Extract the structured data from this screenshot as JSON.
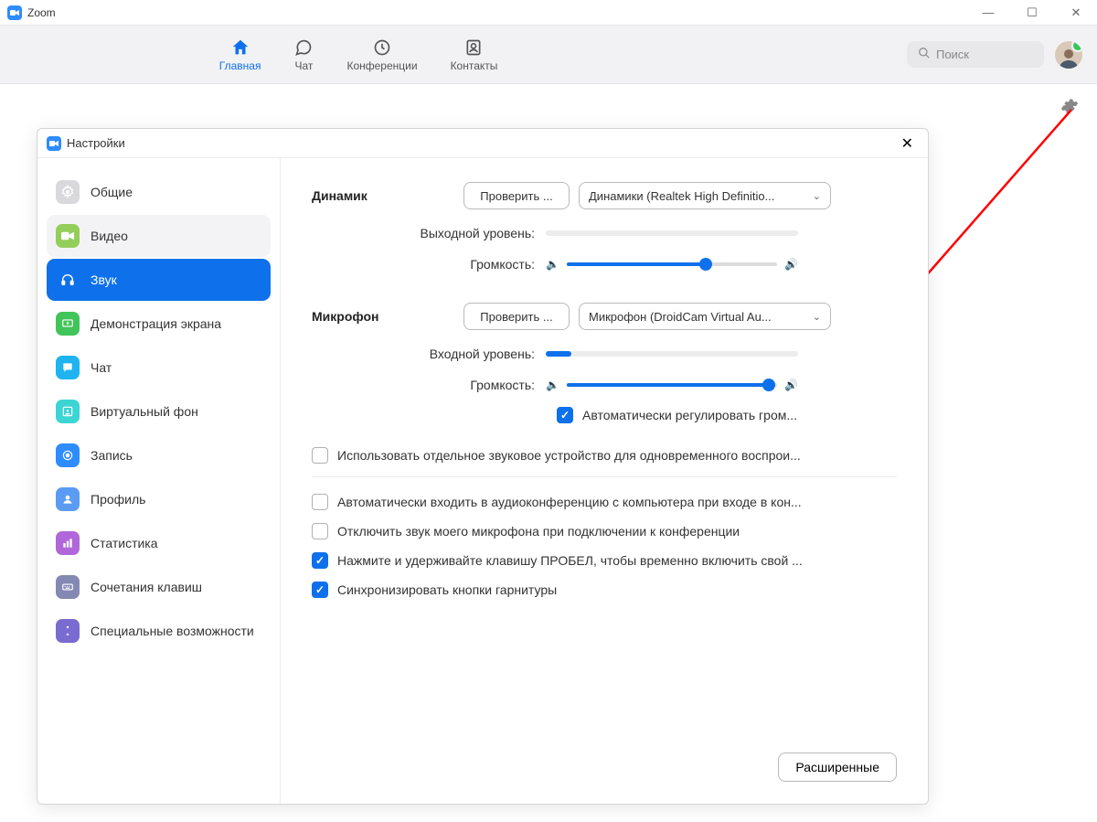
{
  "window": {
    "title": "Zoom"
  },
  "toolbar": {
    "nav": {
      "home": "Главная",
      "chat": "Чат",
      "meetings": "Конференции",
      "contacts": "Контакты"
    },
    "search_placeholder": "Поиск"
  },
  "dialog": {
    "title": "Настройки",
    "sidebar": {
      "general": "Общие",
      "video": "Видео",
      "audio": "Звук",
      "screenshare": "Демонстрация экрана",
      "chat": "Чат",
      "virtualbg": "Виртуальный фон",
      "recording": "Запись",
      "profile": "Профиль",
      "statistics": "Статистика",
      "shortcuts": "Сочетания клавиш",
      "accessibility": "Специальные возможности"
    },
    "audio": {
      "speaker_label": "Динамик",
      "mic_label": "Микрофон",
      "test_btn": "Проверить ...",
      "speaker_device": "Динамики (Realtek High Definitio...",
      "mic_device": "Микрофон (DroidCam Virtual Au...",
      "output_level": "Выходной уровень:",
      "input_level": "Входной уровень:",
      "volume": "Громкость:",
      "speaker_volume_pct": 66,
      "mic_volume_pct": 96,
      "input_level_pct": 10,
      "auto_adjust": "Автоматически регулировать гром...",
      "opt_separate_device": "Использовать отдельное звуковое устройство для одновременного воспрои...",
      "opt_auto_join_audio": "Автоматически входить в аудиоконференцию с компьютера при входе в кон...",
      "opt_mute_on_join": "Отключить звук моего микрофона при подключении к конференции",
      "opt_space_unmute": "Нажмите и удерживайте клавишу ПРОБЕЛ, чтобы временно включить свой ...",
      "opt_sync_headset": "Синхронизировать кнопки гарнитуры",
      "advanced": "Расширенные"
    }
  }
}
